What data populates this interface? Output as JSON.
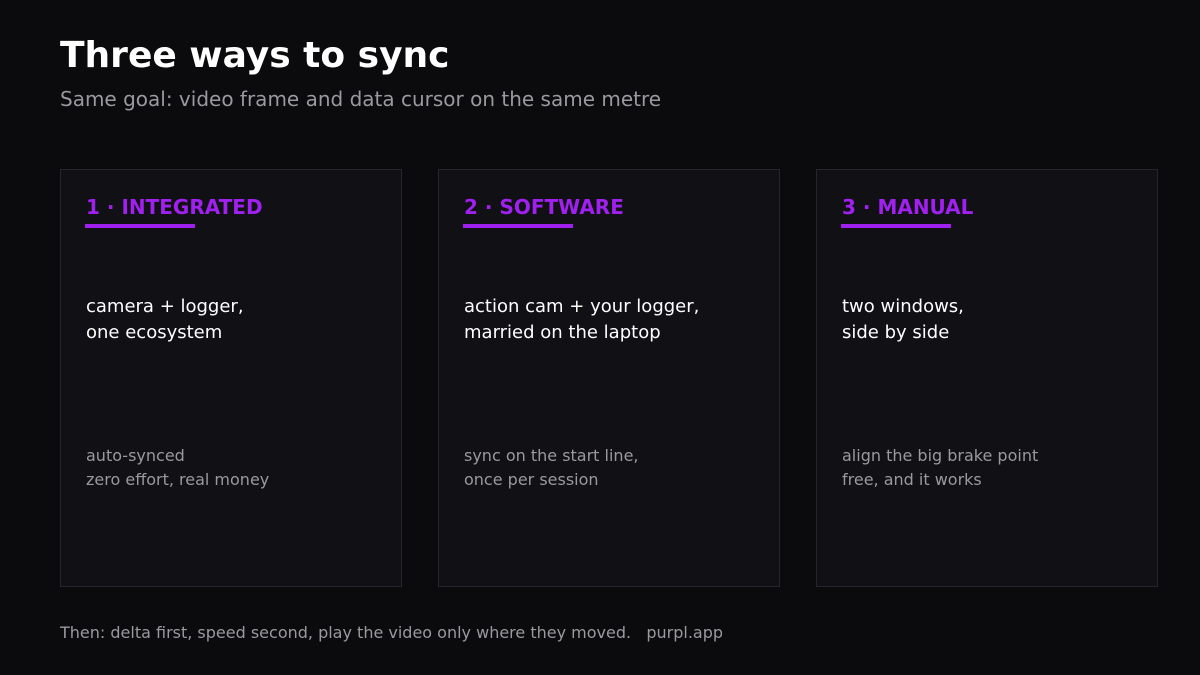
{
  "title": "Three ways to sync",
  "subtitle": "Same goal: video frame and data cursor on the same metre",
  "accent_color": "#a020f0",
  "cards": [
    {
      "label": "1 · INTEGRATED",
      "heading_lines": [
        "camera + logger,",
        "one ecosystem"
      ],
      "note_lines": [
        "auto-synced",
        "zero effort, real money"
      ]
    },
    {
      "label": "2 · SOFTWARE",
      "heading_lines": [
        "action cam + your logger,",
        "married on the laptop"
      ],
      "note_lines": [
        "sync on the start line,",
        "once per session"
      ]
    },
    {
      "label": "3 · MANUAL",
      "heading_lines": [
        "two windows,",
        "side by side"
      ],
      "note_lines": [
        "align the big brake point",
        "free, and it works"
      ]
    }
  ],
  "footer": {
    "text": "Then: delta first, speed second, play the video only where they moved.",
    "brand": "purpl.app"
  }
}
